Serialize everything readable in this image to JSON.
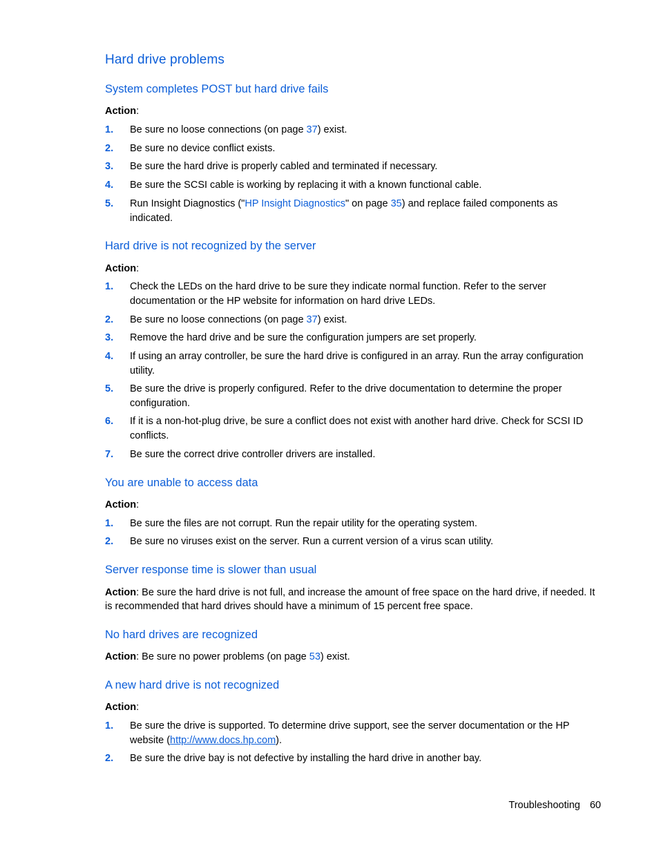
{
  "document": {
    "title": "Hard drive problems",
    "sections": [
      {
        "heading": "System completes POST but hard drive fails",
        "action_label": "Action",
        "items": [
          {
            "num": "1.",
            "pre": "Be sure no loose connections (on page ",
            "link": "37",
            "post": ") exist."
          },
          {
            "num": "2.",
            "text": "Be sure no device conflict exists."
          },
          {
            "num": "3.",
            "text": "Be sure the hard drive is properly cabled and terminated if necessary."
          },
          {
            "num": "4.",
            "text": "Be sure the SCSI cable is working by replacing it with a known functional cable."
          },
          {
            "num": "5.",
            "pre": "Run Insight Diagnostics (\"",
            "link": "HP Insight Diagnostics",
            "mid": "\" on page ",
            "link2": "35",
            "post": ") and replace failed components as indicated."
          }
        ]
      },
      {
        "heading": "Hard drive is not recognized by the server",
        "action_label": "Action",
        "items": [
          {
            "num": "1.",
            "text": "Check the LEDs on the hard drive to be sure they indicate normal function. Refer to the server documentation or the HP website for information on hard drive LEDs."
          },
          {
            "num": "2.",
            "pre": "Be sure no loose connections (on page ",
            "link": "37",
            "post": ") exist."
          },
          {
            "num": "3.",
            "text": "Remove the hard drive and be sure the configuration jumpers are set properly."
          },
          {
            "num": "4.",
            "text": "If using an array controller, be sure the hard drive is configured in an array. Run the array configuration utility."
          },
          {
            "num": "5.",
            "text": "Be sure the drive is properly configured. Refer to the drive documentation to determine the proper configuration."
          },
          {
            "num": "6.",
            "text": "If it is a non-hot-plug drive, be sure a conflict does not exist with another hard drive. Check for SCSI ID conflicts."
          },
          {
            "num": "7.",
            "text": "Be sure the correct drive controller drivers are installed."
          }
        ]
      },
      {
        "heading": "You are unable to access data",
        "action_label": "Action",
        "items": [
          {
            "num": "1.",
            "text": "Be sure the files are not corrupt. Run the repair utility for the operating system."
          },
          {
            "num": "2.",
            "text": "Be sure no viruses exist on the server. Run a current version of a virus scan utility."
          }
        ]
      },
      {
        "heading": "Server response time is slower than usual",
        "action_label": "Action",
        "action_text": ": Be sure the hard drive is not full, and increase the amount of free space on the hard drive, if needed. It is recommended that hard drives should have a minimum of 15 percent free space."
      },
      {
        "heading": "No hard drives are recognized",
        "action_label": "Action",
        "action_pre": ": Be sure no power problems (on page ",
        "action_link": "53",
        "action_post": ") exist."
      },
      {
        "heading": "A new hard drive is not recognized",
        "action_label": "Action",
        "items": [
          {
            "num": "1.",
            "pre": "Be sure the drive is supported. To determine drive support, see the server documentation or the HP website (",
            "link": "http://www.docs.hp.com",
            "post": ")."
          },
          {
            "num": "2.",
            "text": "Be sure the drive bay is not defective by installing the hard drive in another bay."
          }
        ]
      }
    ]
  },
  "footer": {
    "section": "Troubleshooting",
    "page": "60"
  },
  "colors": {
    "heading": "#0d5fd9",
    "link": "#0d5fd9",
    "text": "#000000"
  }
}
